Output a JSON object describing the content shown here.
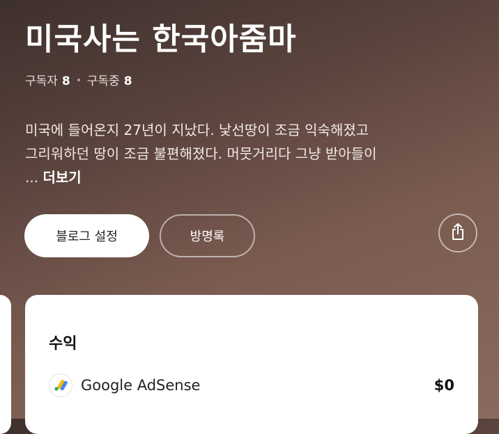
{
  "blog": {
    "title": "미국사는 한국아줌마",
    "subscribers_label": "구독자",
    "subscribers_count": "8",
    "subscribing_label": "구독중",
    "subscribing_count": "8",
    "description_line1": "미국에 들어온지 27년이 지났다.   낯선땅이 조금 익숙해졌고",
    "description_line2": "그리워하던 땅이 조금 불편해졌다.  머뭇거리다 그냥 받아들이",
    "description_ellipsis": "...",
    "more_label": "더보기"
  },
  "actions": {
    "settings_label": "블로그 설정",
    "guestbook_label": "방명록",
    "share_icon": "share-icon"
  },
  "revenue_card": {
    "title": "수익",
    "items": [
      {
        "name": "Google AdSense",
        "value": "$0",
        "icon": "google-adsense-icon"
      }
    ]
  },
  "colors": {
    "background_dark": "#3e302d",
    "background_light": "#8a6a5e",
    "card": "#ffffff",
    "adsense_yellow": "#FBBC04",
    "adsense_blue": "#4285F4",
    "adsense_green": "#34A853"
  }
}
